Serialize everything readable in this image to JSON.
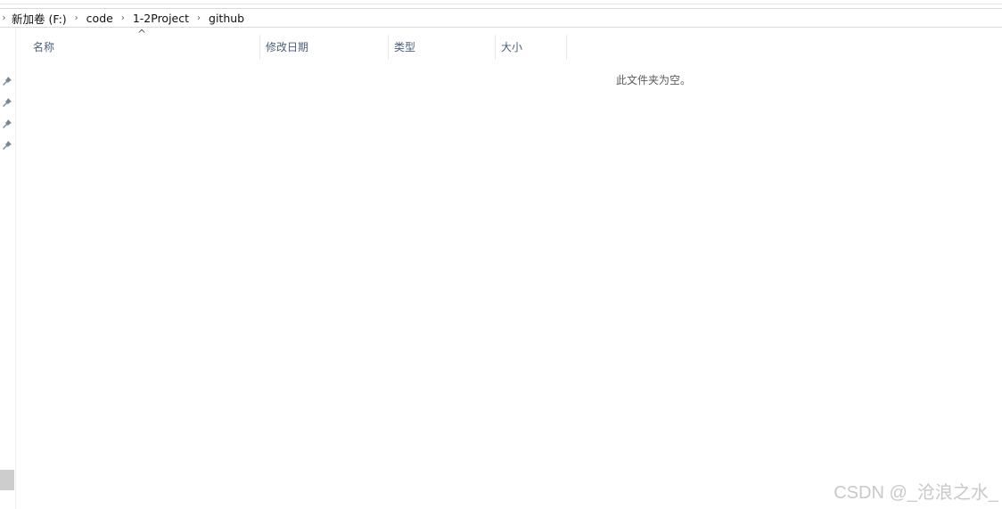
{
  "breadcrumb": {
    "items": [
      "新加卷 (F:)",
      "code",
      "1-2Project",
      "github"
    ]
  },
  "columns": {
    "name": "名称",
    "modified": "修改日期",
    "type": "类型",
    "size": "大小",
    "sort_indicator": "^"
  },
  "empty_message": "此文件夹为空。",
  "watermark": "CSDN @_沧浪之水_",
  "icons": {
    "pin": "pin-icon",
    "chevron": "chevron-right-icon"
  },
  "colors": {
    "header_text": "#4c607a",
    "divider": "#e8e8e8",
    "watermark": "#c9c9c9"
  }
}
